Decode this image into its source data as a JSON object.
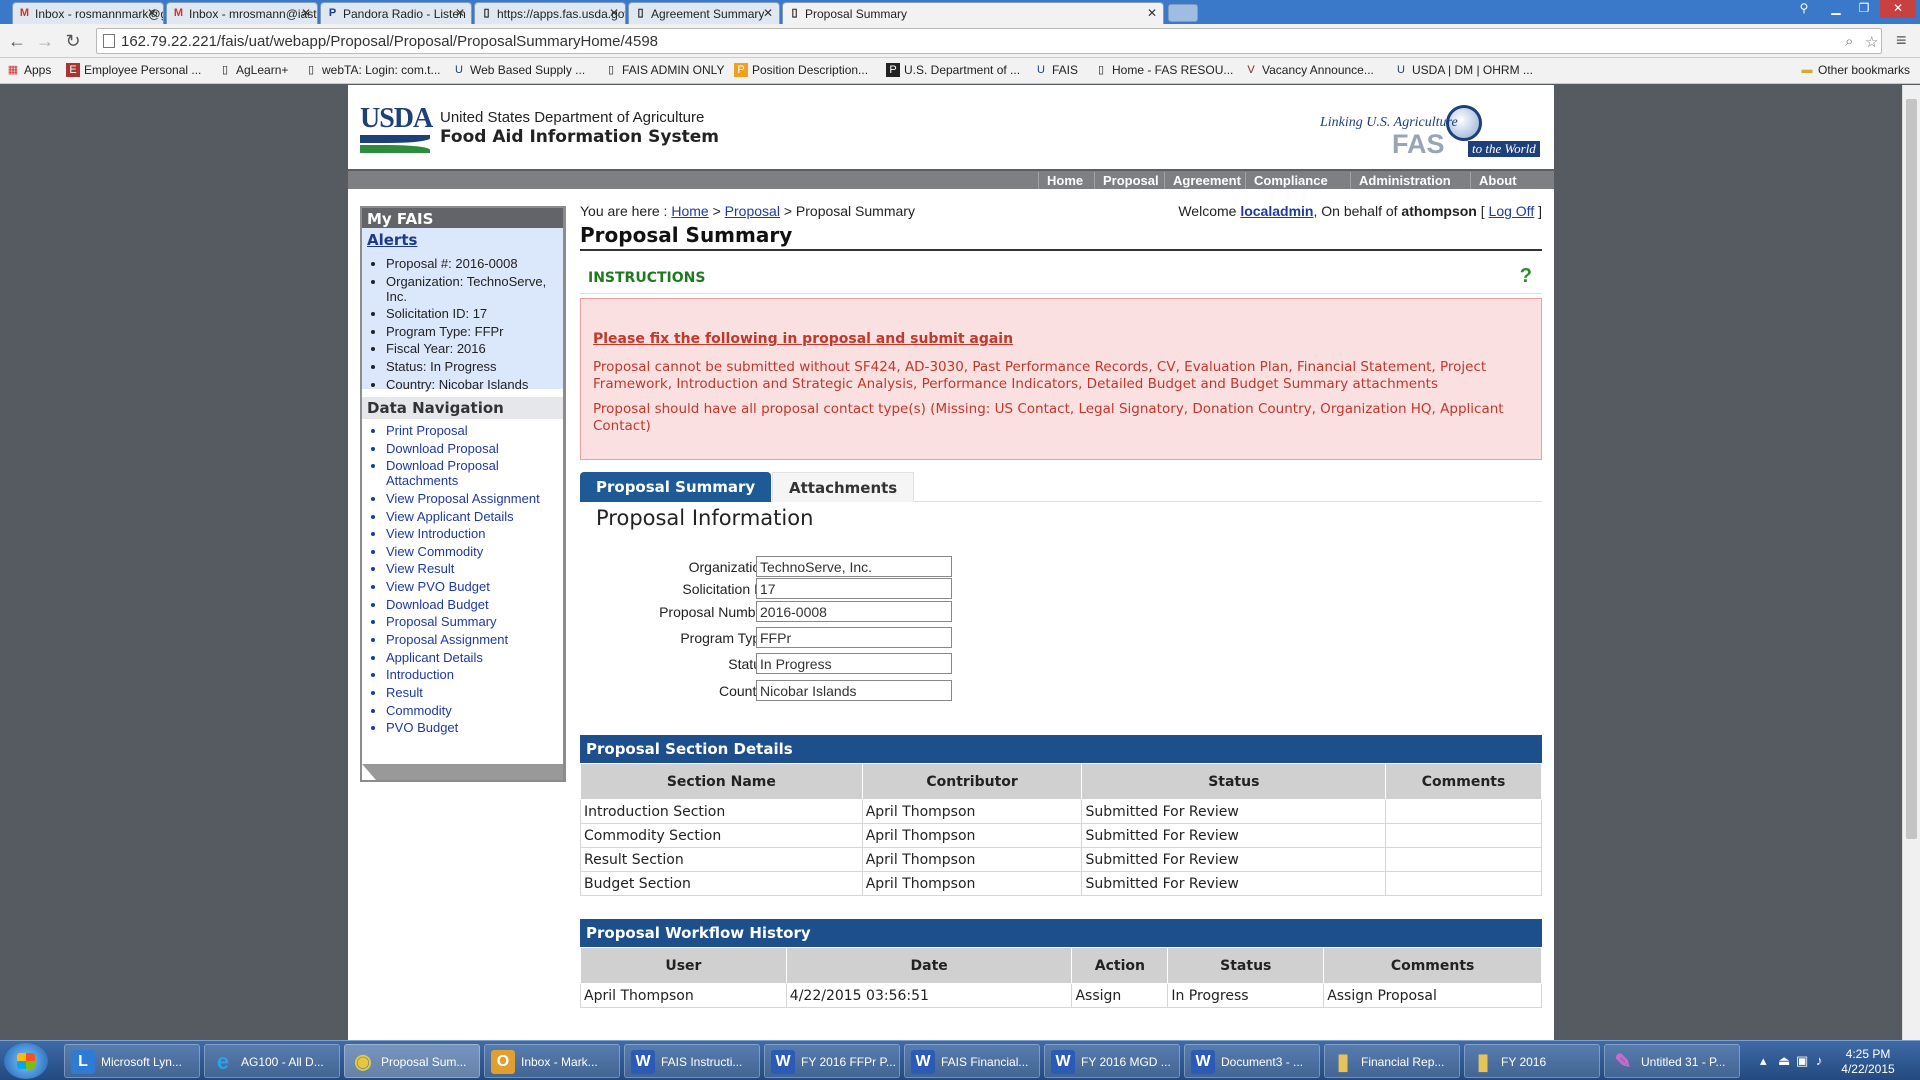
{
  "browser": {
    "tabs": [
      {
        "title": "Inbox - rosmannmark@g",
        "icon": "M"
      },
      {
        "title": "Inbox - mrosmann@iasta",
        "icon": "M"
      },
      {
        "title": "Pandora Radio - Listen",
        "icon": "P"
      },
      {
        "title": "https://apps.fas.usda.gov",
        "icon": "▯"
      },
      {
        "title": "Agreement Summary",
        "icon": "▯"
      },
      {
        "title": "Proposal Summary",
        "icon": "▯"
      }
    ],
    "url": "162.79.22.221/fais/uat/webapp/Proposal/Proposal/ProposalSummaryHome/4598",
    "bookmarks": [
      {
        "label": "Apps",
        "icon": "▦"
      },
      {
        "label": "Employee Personal ...",
        "icon": "E"
      },
      {
        "label": "AgLearn+",
        "icon": "▯"
      },
      {
        "label": "webTA: Login: com.t...",
        "icon": "▯"
      },
      {
        "label": "Web Based Supply ...",
        "icon": "U"
      },
      {
        "label": "FAIS ADMIN ONLY",
        "icon": "▯"
      },
      {
        "label": "Position Description...",
        "icon": "P"
      },
      {
        "label": "U.S. Department of ...",
        "icon": "P"
      },
      {
        "label": "FAIS",
        "icon": "U"
      },
      {
        "label": "Home - FAS RESOU...",
        "icon": "▯"
      },
      {
        "label": "Vacancy Announce...",
        "icon": "V"
      },
      {
        "label": "USDA | DM | OHRM ...",
        "icon": "U"
      }
    ],
    "other_bookmarks": "Other bookmarks"
  },
  "header": {
    "logo_text": "USDA",
    "agency": "United States Department of Agriculture",
    "system": "Food Aid Information System",
    "fas_line1": "Linking U.S. Agriculture",
    "fas_line2": "FAS",
    "fas_line3": "to the World"
  },
  "topnav": [
    "Home",
    "Proposal",
    "Agreement",
    "Compliance",
    "Administration",
    "About FAIS"
  ],
  "sidebar": {
    "title": "My FAIS",
    "alerts_title": "Alerts",
    "alerts": [
      "Proposal #: 2016-0008",
      "Organization: TechnoServe, Inc.",
      "Solicitation ID: 17",
      "Program Type: FFPr",
      "Fiscal Year: 2016",
      "Status: In Progress",
      "Country: Nicobar Islands"
    ],
    "nav_title": "Data Navigation",
    "nav": [
      "Print Proposal",
      "Download Proposal",
      "Download Proposal Attachments",
      "View Proposal Assignment",
      "View Applicant Details",
      "View Introduction",
      "View Commodity",
      "View Result",
      "View PVO Budget",
      "Download Budget",
      "Proposal Summary",
      "Proposal Assignment",
      "Applicant Details",
      "Introduction",
      "Result",
      "Commodity",
      "PVO Budget"
    ]
  },
  "breadcrumb": {
    "prefix": "You are here :",
    "home": "Home",
    "sep": ">",
    "proposal": "Proposal",
    "current": "Proposal Summary"
  },
  "welcome": {
    "prefix": "Welcome",
    "user": "localadmin",
    "behalf": ", On behalf of",
    "behalf_user": "athompson",
    "logoff": "Log Off"
  },
  "page_title": "Proposal Summary",
  "instructions": "INSTRUCTIONS",
  "errors": {
    "title": "Please fix the following in proposal and submit again",
    "messages": [
      "Proposal cannot be submitted without SF424, AD-3030, Past Performance Records, CV, Evaluation Plan, Financial Statement, Project Framework, Introduction and Strategic Analysis, Performance Indicators, Detailed Budget and Budget Summary attachments",
      "Proposal should have all proposal contact type(s) (Missing: US Contact, Legal Signatory, Donation Country, Organization HQ, Applicant Contact)"
    ]
  },
  "tabs": {
    "active": "Proposal Summary",
    "other": "Attachments"
  },
  "proposal_info": {
    "title": "Proposal Information",
    "fields": [
      {
        "label": "Organization",
        "value": "TechnoServe, Inc."
      },
      {
        "label": "Solicitation ID",
        "value": "17"
      },
      {
        "label": "Proposal Number",
        "value": "2016-0008"
      },
      {
        "label": "Program Type",
        "value": "FFPr"
      },
      {
        "label": "Status",
        "value": "In Progress"
      },
      {
        "label": "Country",
        "value": "Nicobar Islands"
      }
    ]
  },
  "section_details": {
    "title": "Proposal Section Details",
    "columns": [
      "Section Name",
      "Contributor",
      "Status",
      "Comments"
    ],
    "rows": [
      [
        "Introduction Section",
        "April Thompson",
        "Submitted For Review",
        ""
      ],
      [
        "Commodity Section",
        "April Thompson",
        "Submitted For Review",
        ""
      ],
      [
        "Result Section",
        "April Thompson",
        "Submitted For Review",
        ""
      ],
      [
        "Budget Section",
        "April Thompson",
        "Submitted For Review",
        ""
      ]
    ]
  },
  "workflow": {
    "title": "Proposal Workflow History",
    "columns": [
      "User",
      "Date",
      "Action",
      "Status",
      "Comments"
    ],
    "rows": [
      [
        "April Thompson",
        "4/22/2015 03:56:51",
        "Assign",
        "In Progress",
        "Assign Proposal"
      ]
    ]
  },
  "taskbar": {
    "items": [
      {
        "label": "Microsoft Lyn...",
        "icon": "L",
        "color": "#2e7bd6"
      },
      {
        "label": "AG100 - All D...",
        "icon": "e",
        "color": "#2aa0e8"
      },
      {
        "label": "Proposal Sum...",
        "icon": "◉",
        "color": "#e8c83a"
      },
      {
        "label": "Inbox - Mark...",
        "icon": "O",
        "color": "#e0a030"
      },
      {
        "label": "FAIS Instructi...",
        "icon": "W",
        "color": "#2b5bb5"
      },
      {
        "label": "FY 2016 FFPr P...",
        "icon": "W",
        "color": "#2b5bb5"
      },
      {
        "label": "FAIS Financial...",
        "icon": "W",
        "color": "#2b5bb5"
      },
      {
        "label": "FY 2016 MGD ...",
        "icon": "W",
        "color": "#2b5bb5"
      },
      {
        "label": "Document3 - ...",
        "icon": "W",
        "color": "#2b5bb5"
      },
      {
        "label": "Financial Rep...",
        "icon": "▮",
        "color": "#e8c35a"
      },
      {
        "label": "FY 2016",
        "icon": "▮",
        "color": "#e8c35a"
      },
      {
        "label": "Untitled 31 - P...",
        "icon": "✎",
        "color": "#d06ad0"
      }
    ],
    "time": "4:25 PM",
    "date": "4/22/2015"
  }
}
